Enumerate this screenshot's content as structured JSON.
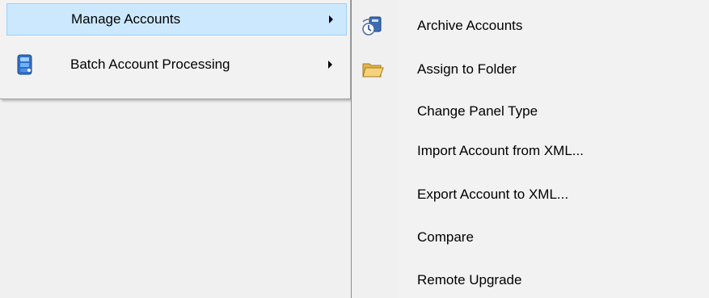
{
  "parent_menu": {
    "items": [
      {
        "label": "Manage Accounts",
        "icon": "none",
        "highlighted": true,
        "has_submenu": true
      },
      {
        "label": "Batch Account Processing",
        "icon": "batch-processing-icon",
        "highlighted": false,
        "has_submenu": true
      }
    ]
  },
  "submenu": {
    "items": [
      {
        "label": "Archive Accounts",
        "icon": "archive-accounts-icon"
      },
      {
        "label": "Assign to Folder",
        "icon": "folder-icon"
      },
      {
        "label": "Change Panel Type",
        "icon": "none"
      },
      {
        "label": "Import Account from XML...",
        "icon": "none"
      },
      {
        "label": "Export Account to XML...",
        "icon": "none"
      },
      {
        "label": "Compare",
        "icon": "none"
      },
      {
        "label": "Remote Upgrade",
        "icon": "none"
      }
    ]
  },
  "colors": {
    "highlight_fill": "#cce8ff",
    "highlight_border": "#99d1ff",
    "menu_background": "#f2f2f2"
  }
}
